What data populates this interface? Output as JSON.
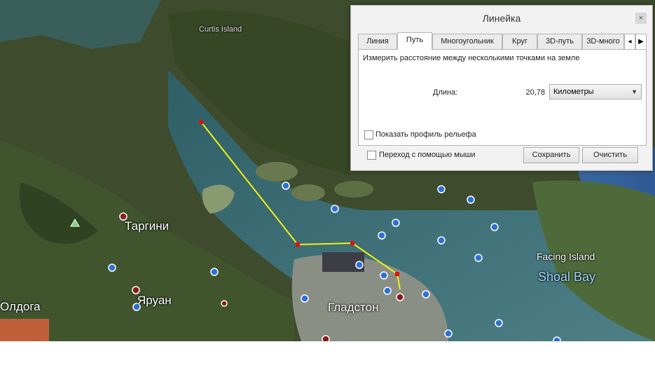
{
  "map": {
    "labels": {
      "curtis_island": "Curtis Island",
      "targini": "Таргини",
      "yaruan": "Яруан",
      "oldoga": "Олдога",
      "gladstone": "Гладстон",
      "facing_island": "Facing Island",
      "shoal_bay": "Shoal Bay"
    },
    "colors": {
      "path": "#f2f20a",
      "vertex": "#e01010",
      "water": "#3d6b72",
      "land": "#3a4a2a"
    }
  },
  "ruler": {
    "title": "Линейка",
    "close_icon": "×",
    "tabs": [
      "Линия",
      "Путь",
      "Многоугольник",
      "Круг",
      "3D-путь",
      "3D-много"
    ],
    "active_tab": "Путь",
    "scroll_icon": "▶",
    "description": "Измерить расстояние между несколькими точками на земле",
    "length_label": "Длина:",
    "length_value": "20,78",
    "unit": "Километры",
    "show_elevation_label": "Показать профиль рельефа",
    "mouse_nav_label": "Переход с помощью мыши",
    "save_label": "Сохранить",
    "clear_label": "Очистить"
  }
}
